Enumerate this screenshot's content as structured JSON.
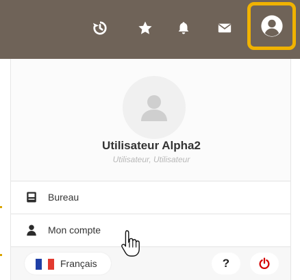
{
  "topbar": {
    "icons": [
      "history-icon",
      "star-icon",
      "bell-icon",
      "mail-icon",
      "user-circle-icon"
    ],
    "bg_color": "#6f6358",
    "highlight_color": "#f0b200"
  },
  "user": {
    "name": "Utilisateur Alpha2",
    "roles": "Utilisateur, Utilisateur"
  },
  "menu": {
    "items": [
      {
        "label": "Bureau",
        "icon": "desktop-icon"
      },
      {
        "label": "Mon compte",
        "icon": "user-icon"
      }
    ]
  },
  "footer": {
    "language": "Français",
    "help_label": "?",
    "power_color": "#d40000"
  }
}
